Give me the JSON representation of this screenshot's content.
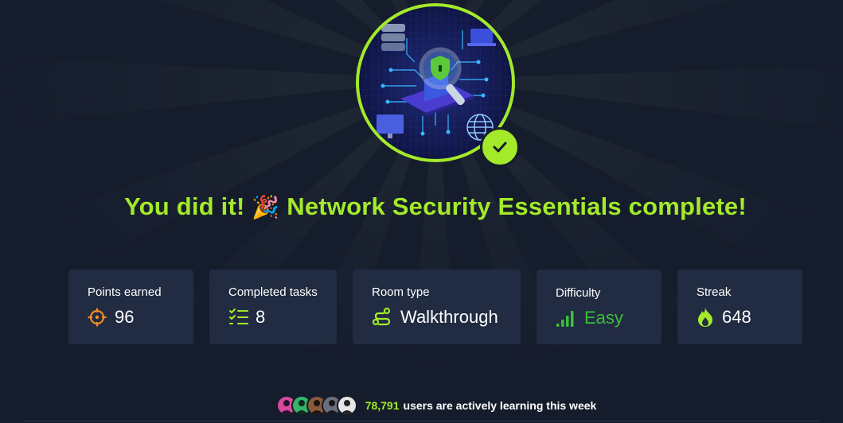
{
  "colors": {
    "accent": "#a3ea2a",
    "background": "#151c2b",
    "card": "#212c42",
    "points_icon": "#f28b1f",
    "easy": "#3bbf3b"
  },
  "completion": {
    "prefix": "You did it!",
    "emoji": "🎉",
    "suffix": "Network Security Essentials complete!"
  },
  "badge": {
    "icon": "room-badge-image",
    "check_icon": "checkmark-icon"
  },
  "stats": [
    {
      "label": "Points earned",
      "value": "96",
      "icon": "target-icon"
    },
    {
      "label": "Completed tasks",
      "value": "8",
      "icon": "checklist-icon"
    },
    {
      "label": "Room type",
      "value": "Walkthrough",
      "icon": "route-icon"
    },
    {
      "label": "Difficulty",
      "value": "Easy",
      "icon": "signal-bars-icon"
    },
    {
      "label": "Streak",
      "value": "648",
      "icon": "fire-icon"
    }
  ],
  "learners": {
    "count": "78,791",
    "text": "users are actively learning this week",
    "avatar_count": 5
  }
}
